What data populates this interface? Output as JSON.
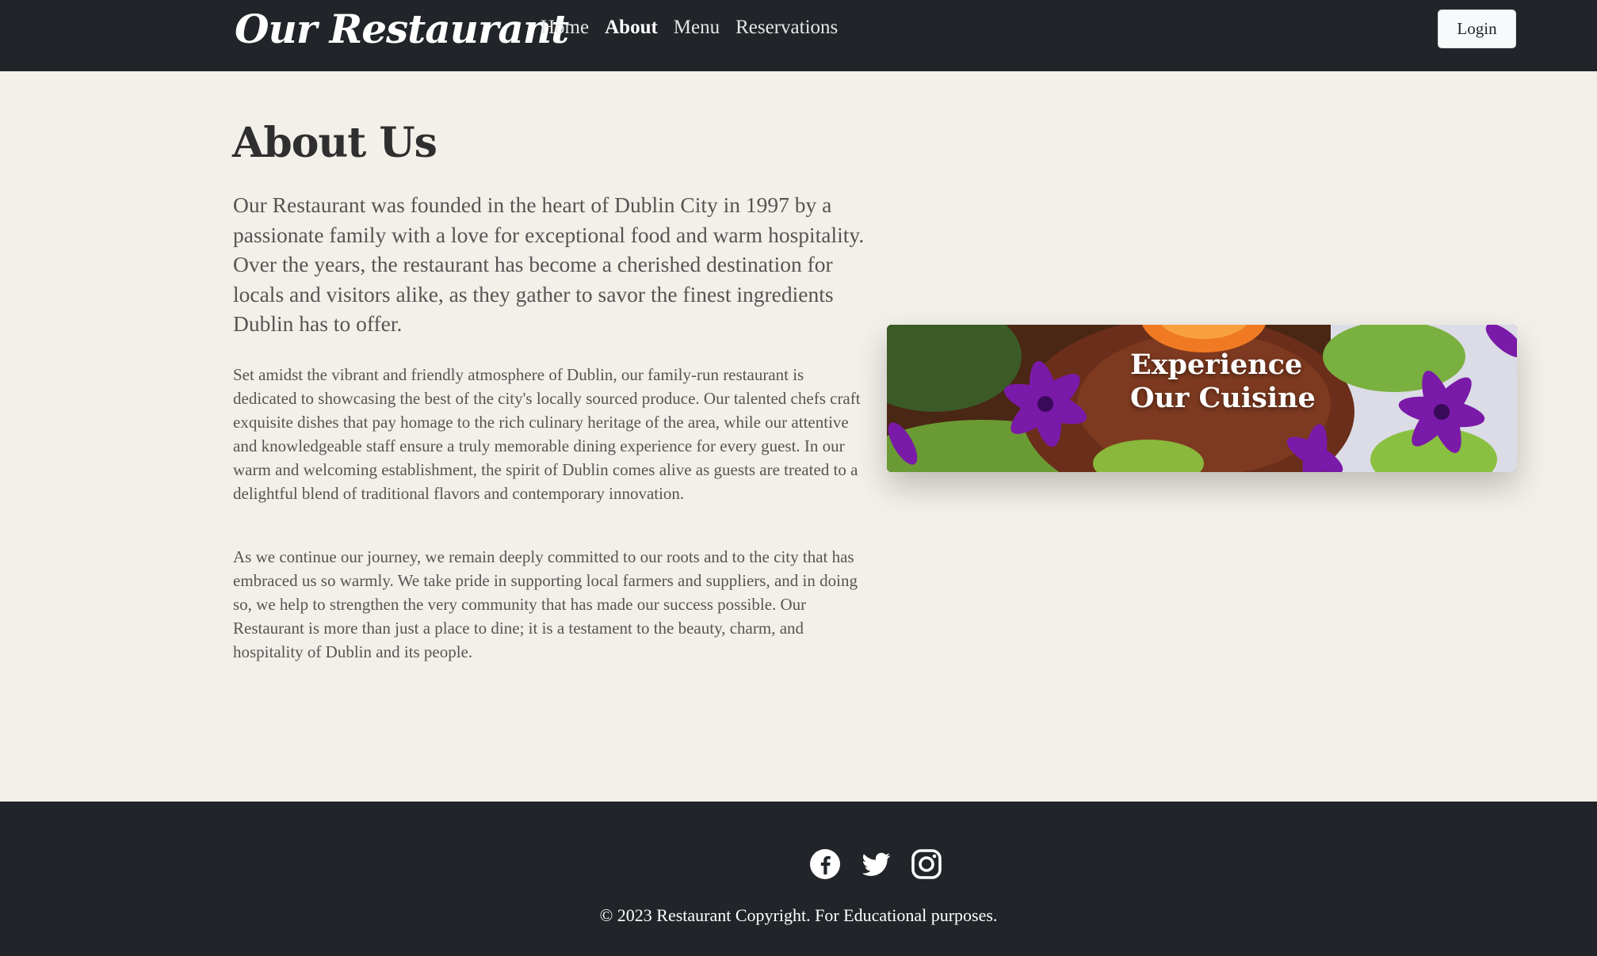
{
  "navbar": {
    "brand": "Our Restaurant",
    "links": [
      {
        "label": "Home",
        "active": false
      },
      {
        "label": "About",
        "active": true
      },
      {
        "label": "Menu",
        "active": false
      },
      {
        "label": "Reservations",
        "active": false
      }
    ],
    "login_label": "Login",
    "background_color": "#212529"
  },
  "main": {
    "title": "About Us",
    "lead": "Our Restaurant was founded in the heart of Dublin City in 1997 by a passionate family with a love for exceptional food and warm hospitality. Over the years, the restaurant has become a cherished destination for locals and visitors alike, as they gather to savor the finest ingredients Dublin has to offer.",
    "paragraphs": [
      "Set amidst the vibrant and friendly atmosphere of Dublin, our family-run restaurant is dedicated to showcasing the best of the city's locally sourced produce. Our talented chefs craft exquisite dishes that pay homage to the rich culinary heritage of the area, while our attentive and knowledgeable staff ensure a truly memorable dining experience for every guest. In our warm and welcoming establishment, the spirit of Dublin comes alive as guests are treated to a delightful blend of traditional flavors and contemporary innovation.",
      "As we continue our journey, we remain deeply committed to our roots and to the city that has embraced us so warmly. We take pride in supporting local farmers and suppliers, and in doing so, we help to strengthen the very community that has made our success possible. Our Restaurant is more than just a place to dine; it is a testament to the beauty, charm, and hospitality of Dublin and its people."
    ],
    "banner_text": "Experience Our Cuisine",
    "background_color": "#f3f0e9"
  },
  "footer": {
    "social_icons": [
      "facebook-icon",
      "twitter-icon",
      "instagram-icon"
    ],
    "copyright": "© 2023 Restaurant Copyright. For Educational purposes.",
    "background_color": "#212529"
  }
}
